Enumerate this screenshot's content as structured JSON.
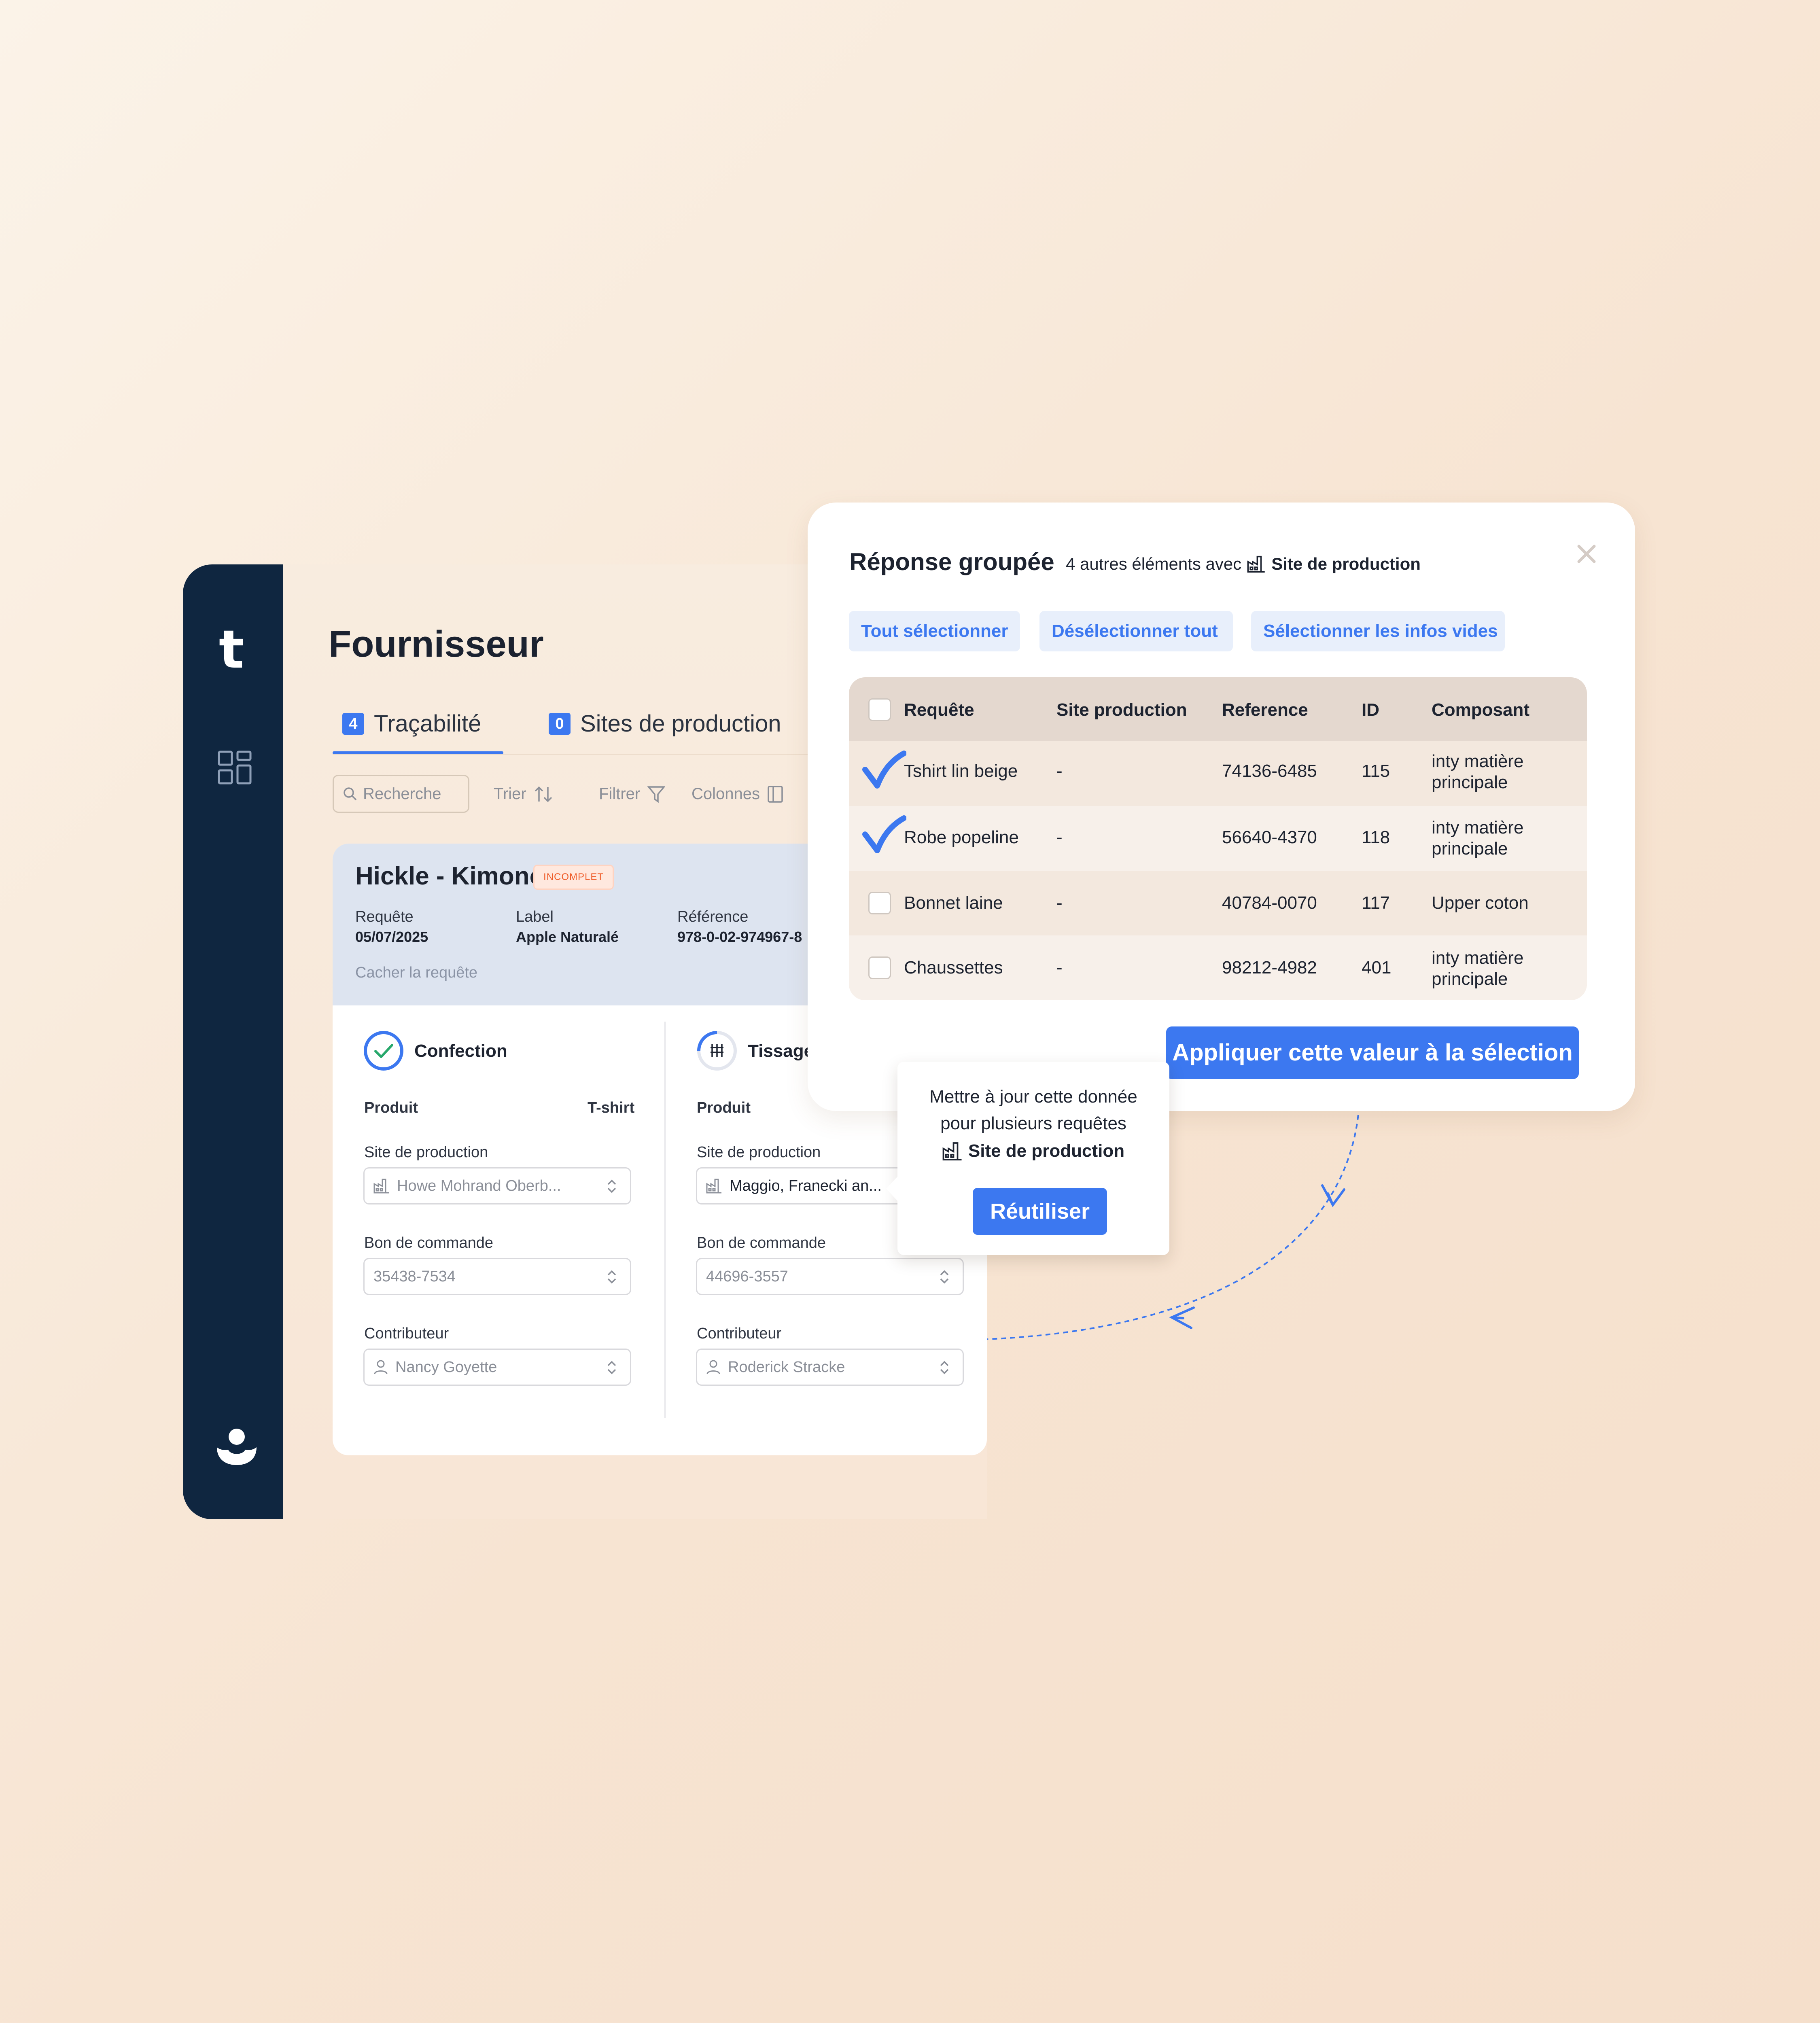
{
  "app": {
    "logo": "t",
    "icons": {
      "dashboard": "grid-icon",
      "user": "user-icon"
    },
    "page_title": "Fournisseur",
    "tabs": [
      {
        "count": "4",
        "label": "Traçabilité",
        "active": true
      },
      {
        "count": "0",
        "label": "Sites de production",
        "active": false
      }
    ],
    "toolbar": {
      "search_placeholder": "Recherche",
      "sort_label": "Trier",
      "filter_label": "Filtrer",
      "columns_label": "Colonnes"
    },
    "request_card": {
      "title": "Hickle - Kimono",
      "status": "INCOMPLET",
      "meta": [
        {
          "label": "Requête",
          "value": "05/07/2025"
        },
        {
          "label": "Label",
          "value": "Apple Naturalé"
        },
        {
          "label": "Référence",
          "value": "978-0-02-974967-8"
        }
      ],
      "hide_link": "Cacher la requête",
      "steps": [
        {
          "title": "Confection",
          "product_label": "Produit",
          "product_value": "T-shirt",
          "site_label": "Site de production",
          "site_value": "Howe Mohrand Oberb...",
          "po_label": "Bon de commande",
          "po_value": "35438-7534",
          "contrib_label": "Contributeur",
          "contrib_value": "Nancy Goyette"
        },
        {
          "title": "Tissage",
          "product_label": "Produit",
          "site_label": "Site de production",
          "site_value": "Maggio, Franecki an...",
          "po_label": "Bon de commande",
          "po_value": "44696-3557",
          "contrib_label": "Contributeur",
          "contrib_value": "Roderick Stracke"
        }
      ]
    }
  },
  "modal": {
    "title": "Réponse groupée",
    "subtitle_prefix": "4 autres éléments avec",
    "subtitle_field": "Site de production",
    "buttons": {
      "select_all": "Tout sélectionner",
      "deselect_all": "Désélectionner tout",
      "select_empty": "Sélectionner les infos vides"
    },
    "table": {
      "columns": [
        "Requête",
        "Site production",
        "Reference",
        "ID",
        "Composant"
      ],
      "rows": [
        {
          "checked": true,
          "request": "Tshirt lin beige",
          "site": "-",
          "reference": "74136-6485",
          "id": "115",
          "component": "inty matière principale"
        },
        {
          "checked": true,
          "request": "Robe popeline",
          "site": "-",
          "reference": "56640-4370",
          "id": "118",
          "component": "inty matière principale"
        },
        {
          "checked": false,
          "request": "Bonnet laine",
          "site": "-",
          "reference": "40784-0070",
          "id": "117",
          "component": "Upper coton"
        },
        {
          "checked": false,
          "request": "Chaussettes",
          "site": "-",
          "reference": "98212-4982",
          "id": "401",
          "component": "inty matière principale"
        }
      ]
    },
    "apply_button": "Appliquer cette valeur à la sélection"
  },
  "tooltip": {
    "line1": "Mettre à jour cette donnée",
    "line2": "pour plusieurs requêtes",
    "field": "Site de production",
    "button": "Réutiliser"
  },
  "colors": {
    "accent": "#3c78f0",
    "sidebar": "#0f2640",
    "badge_text": "#ef5d2a",
    "badge_bg": "#ffe8de"
  }
}
